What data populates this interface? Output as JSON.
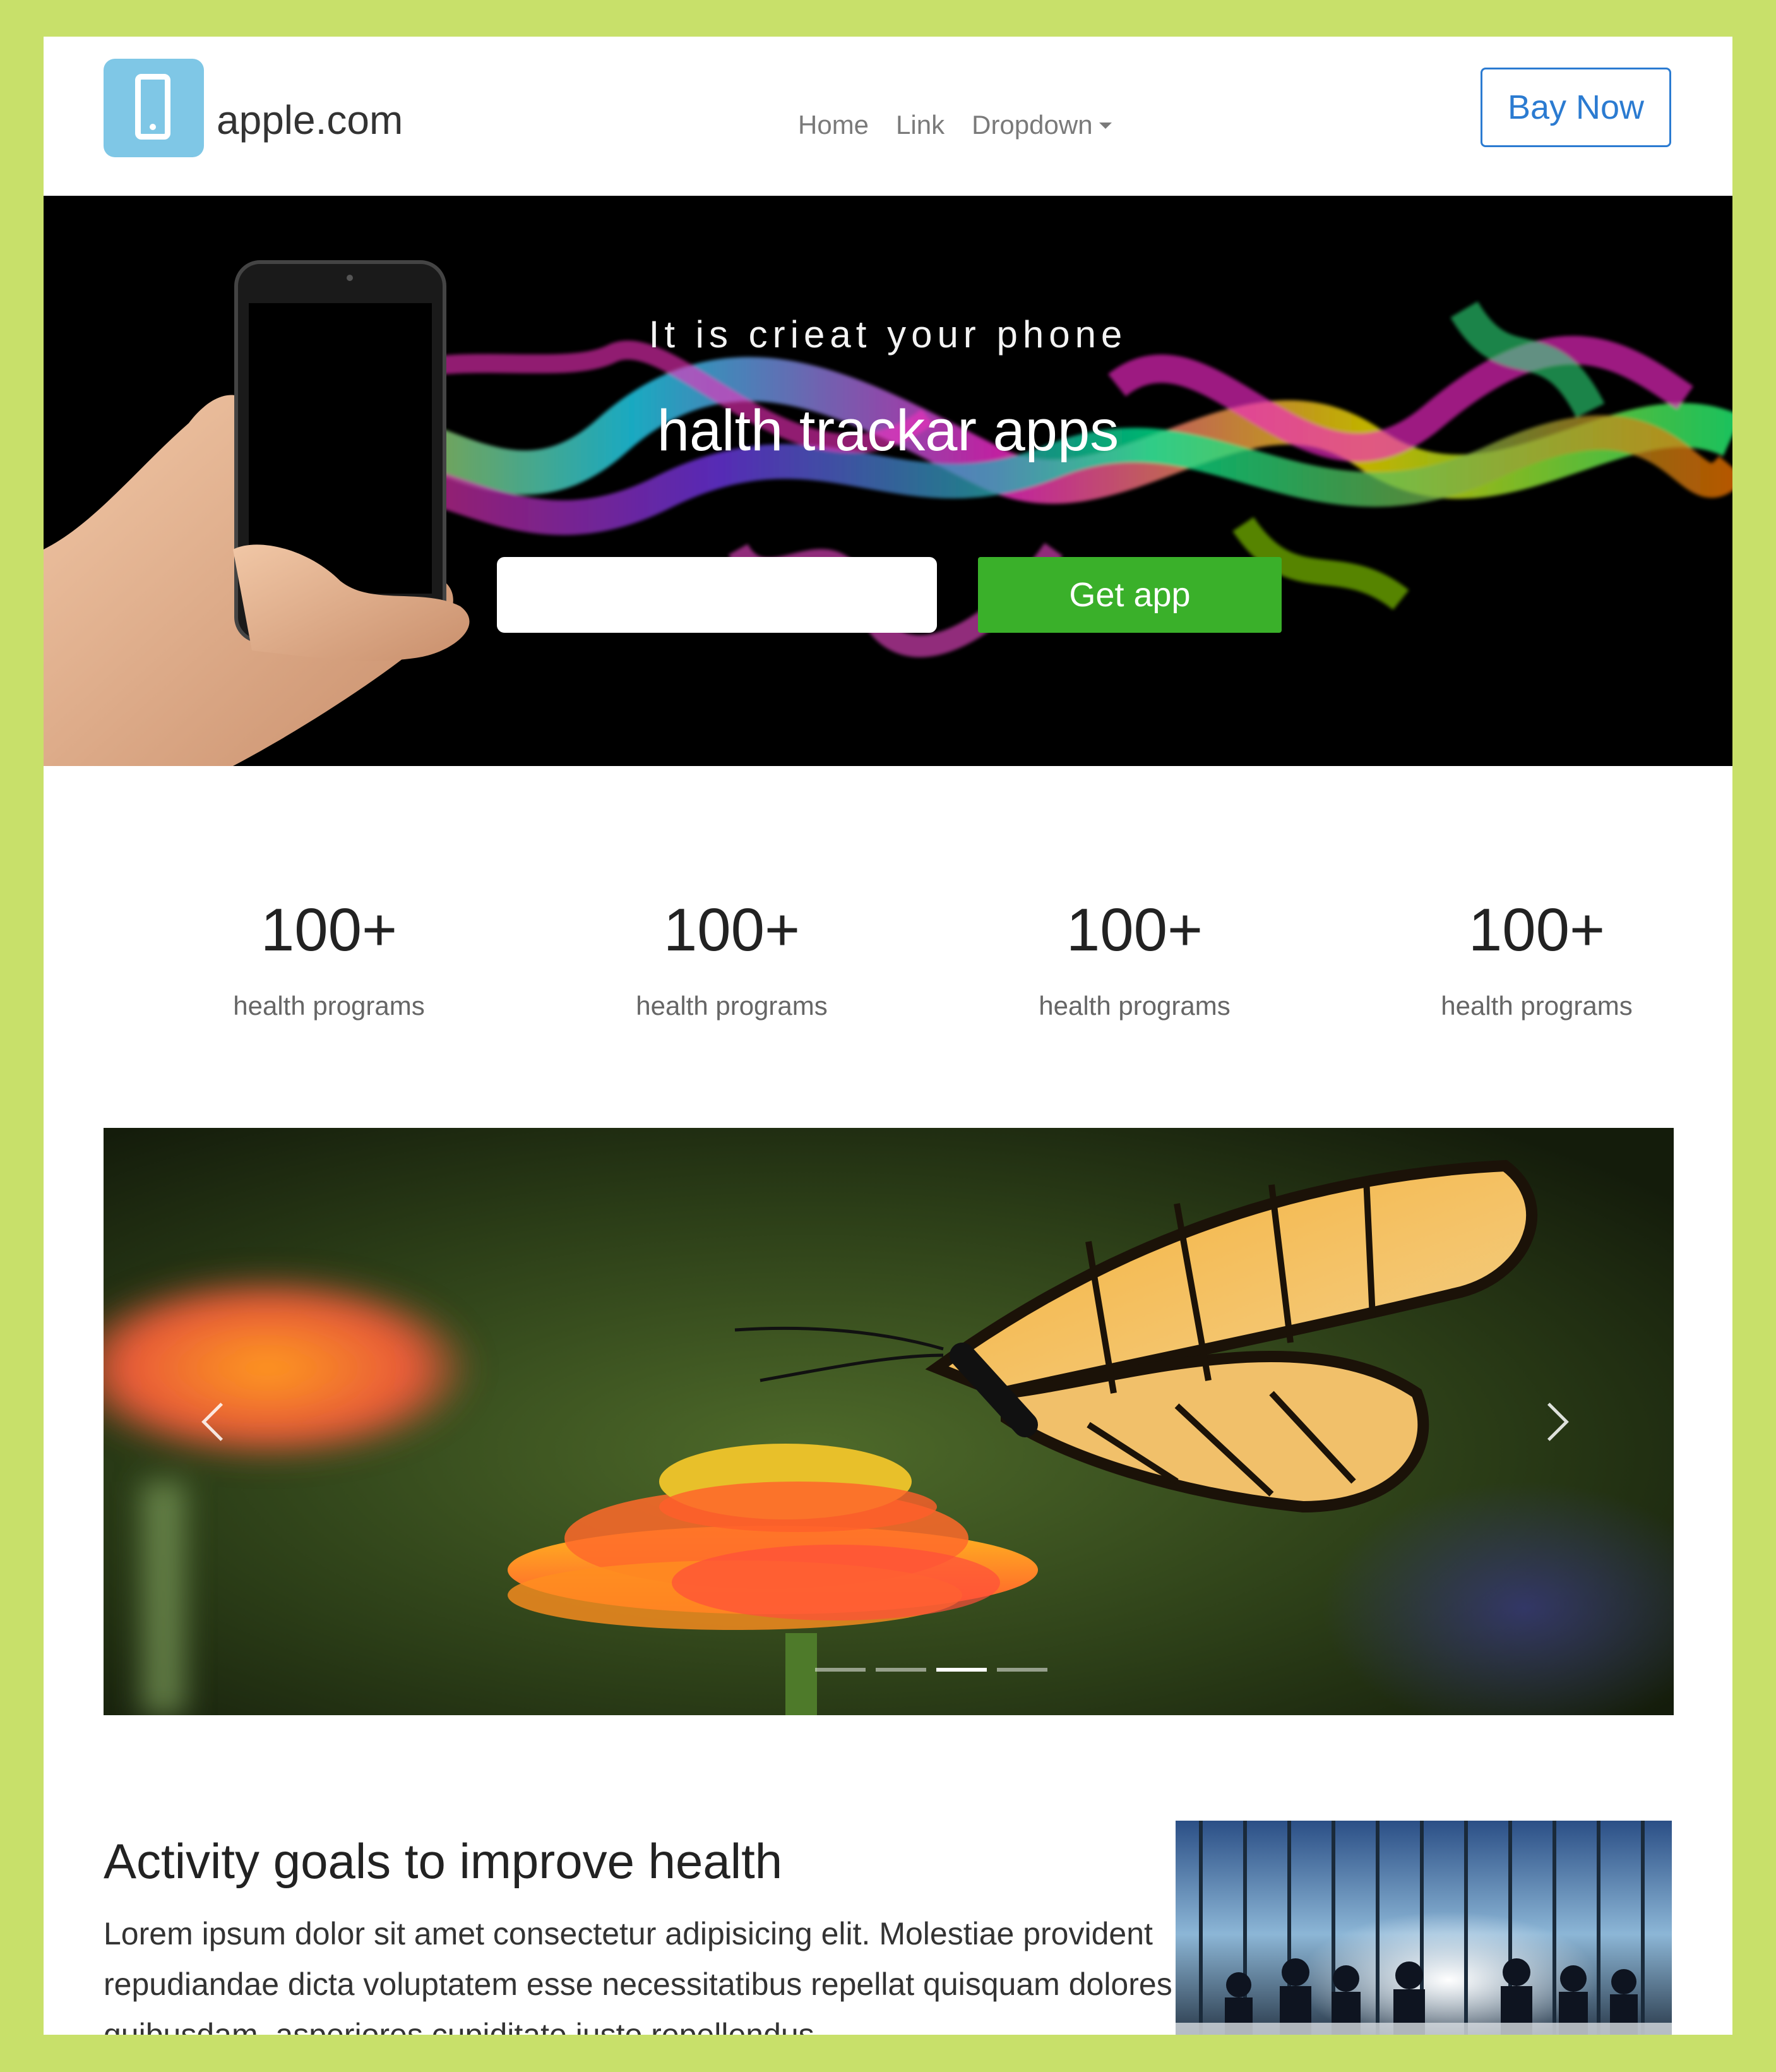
{
  "navbar": {
    "brand": "apple.com",
    "brand_icon": "phone-icon",
    "links": [
      "Home",
      "Link",
      "Dropdown"
    ],
    "buy_button": "Bay Now"
  },
  "hero": {
    "subtitle": "It is crieat your phone",
    "title": "halth trackar apps",
    "input_value": "",
    "button": "Get app"
  },
  "stats": [
    {
      "value": "100+",
      "label": "health programs"
    },
    {
      "value": "100+",
      "label": "health programs"
    },
    {
      "value": "100+",
      "label": "health programs"
    },
    {
      "value": "100+",
      "label": "health programs"
    }
  ],
  "carousel": {
    "slides": 4,
    "active_index": 2,
    "prev_icon": "chevron-left-icon",
    "next_icon": "chevron-right-icon"
  },
  "article": {
    "title": "Activity goals to improve health",
    "body": "Lorem ipsum dolor sit amet consectetur adipisicing elit. Molestiae provident repudiandae dicta voluptatem esse necessitatibus repellat quisquam dolores quibusdam, asperiores cupiditate iusto repellendus"
  },
  "colors": {
    "outer_background": "#c8e06a",
    "accent_blue": "#2b7bd1",
    "get_app_green": "#3ab02a",
    "brand_icon_blue": "#7fc7e6"
  }
}
